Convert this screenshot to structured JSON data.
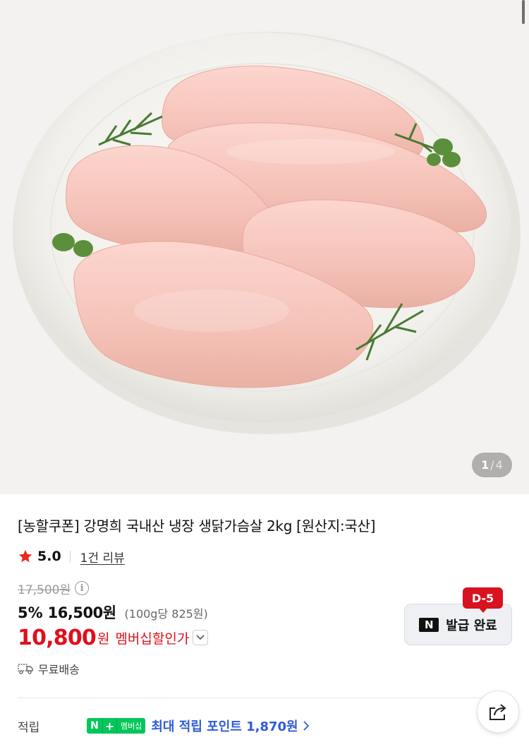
{
  "gallery": {
    "current": "1",
    "separator": "/",
    "total": "4"
  },
  "product": {
    "title": "[농할쿠폰] 강명희 국내산 냉장 생닭가슴살 2kg [원산지:국산]",
    "rating": "5.0",
    "review_link": "1건 리뷰",
    "original_price": "17,500원",
    "discount_rate": "5%",
    "sale_price": "16,500원",
    "unit_price": "(100g당 825원)",
    "member_price": "10,800",
    "member_price_suffix": "원",
    "member_label": "멤버십할인가",
    "shipping": "무료배송",
    "points_label": "적립",
    "points_badge_n": "N",
    "points_badge_plus": "+",
    "points_badge_text": "멤버십",
    "points_text": "최대 적립 포인트 1,870원"
  },
  "coupon": {
    "dday": "D-5",
    "label": "발급 완료",
    "logo": "N"
  },
  "colors": {
    "accent_red": "#e0101b",
    "points_blue": "#2f5bd8",
    "naver_green": "#03c75a"
  },
  "icons": [
    "star-icon",
    "info-icon",
    "chevron-down-icon",
    "truck-icon",
    "chevron-right-icon",
    "share-icon"
  ]
}
